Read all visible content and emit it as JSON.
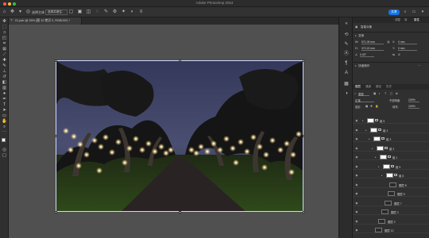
{
  "app_title": "Adobe Photoshop 2024",
  "options_bar": {
    "select_subject_label": "选择主体",
    "select_and_mask_label": "选择并遮住…",
    "share_label": "共享"
  },
  "document": {
    "tab_label": "01.psb @ 25% (图 12 拷贝 2, RGB/16*) *"
  },
  "properties": {
    "tabs": [
      "属性",
      "调整",
      "库"
    ],
    "section_label": "智能对象",
    "transform_label": "变换",
    "w_label": "W:",
    "w_value": "571.09 mm",
    "x_label": "X:",
    "x_value": "0 mm",
    "h_label": "H:",
    "h_value": "372.22 mm",
    "y_label": "Y:",
    "y_value": "0 mm",
    "angle_label": "∠",
    "angle_value": "0.00°",
    "quick_actions_label": "快速操作"
  },
  "layers": {
    "tabs": [
      "图层",
      "通道",
      "路径",
      "历史"
    ],
    "kind_filter": "类型",
    "blend_mode": "正常",
    "opacity_label": "不透明度:",
    "opacity_value": "100%",
    "lock_label": "锁定:",
    "fill_label": "填充:",
    "fill_value": "100%",
    "rows": [
      {
        "name": "组 5",
        "type": "group"
      },
      {
        "name": "组 4",
        "type": "group"
      },
      {
        "name": "组 3",
        "type": "group"
      },
      {
        "name": "组 2",
        "type": "group"
      },
      {
        "name": "组 1",
        "type": "group"
      },
      {
        "name": "组 9",
        "type": "group"
      },
      {
        "name": "组 8",
        "type": "group"
      },
      {
        "name": "图层 8",
        "type": "layer"
      },
      {
        "name": "图层 5",
        "type": "layer"
      },
      {
        "name": "图层 7",
        "type": "layer"
      },
      {
        "name": "图层 3",
        "type": "layer"
      },
      {
        "name": "图层 2",
        "type": "layer"
      },
      {
        "name": "图层 12",
        "type": "layer"
      }
    ]
  },
  "icons": {
    "close": "close-icon",
    "minimize": "minimize-icon",
    "zoom": "zoom-icon",
    "home": "home-icon",
    "move": "move-tool-icon",
    "search": "search-icon",
    "eye": "visibility-eye-icon"
  },
  "colors": {
    "accent": "#1473e6",
    "foreground_swatch": "#ffffff",
    "background_swatch": "#000000"
  }
}
